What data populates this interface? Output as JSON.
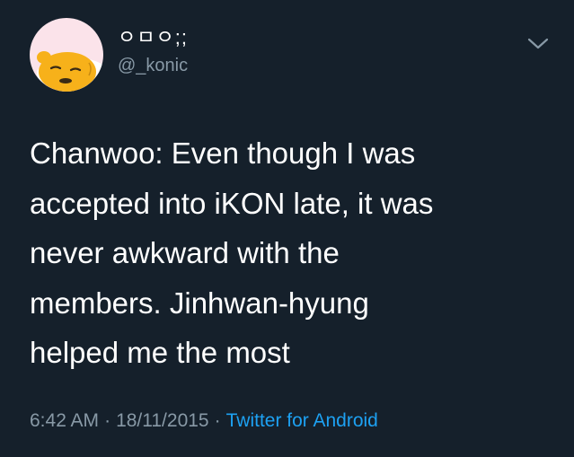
{
  "tweet": {
    "author": {
      "display_name": "ㅇㅁㅇ;;",
      "handle": "@_konic",
      "avatar": "gudetama-egg-avatar"
    },
    "text": "Chanwoo: Even though I was\naccepted into iKON late, it was\nnever awkward with the\nmembers. Jinhwan-hyung\nhelped me the most",
    "meta": {
      "time": "6:42 AM",
      "separator": "·",
      "date": "18/11/2015",
      "source": "Twitter for Android"
    },
    "menu_icon": "chevron-down-icon"
  },
  "colors": {
    "background": "#15202b",
    "text": "#ffffff",
    "secondary": "#8899a6",
    "accent": "#1da1f2"
  }
}
